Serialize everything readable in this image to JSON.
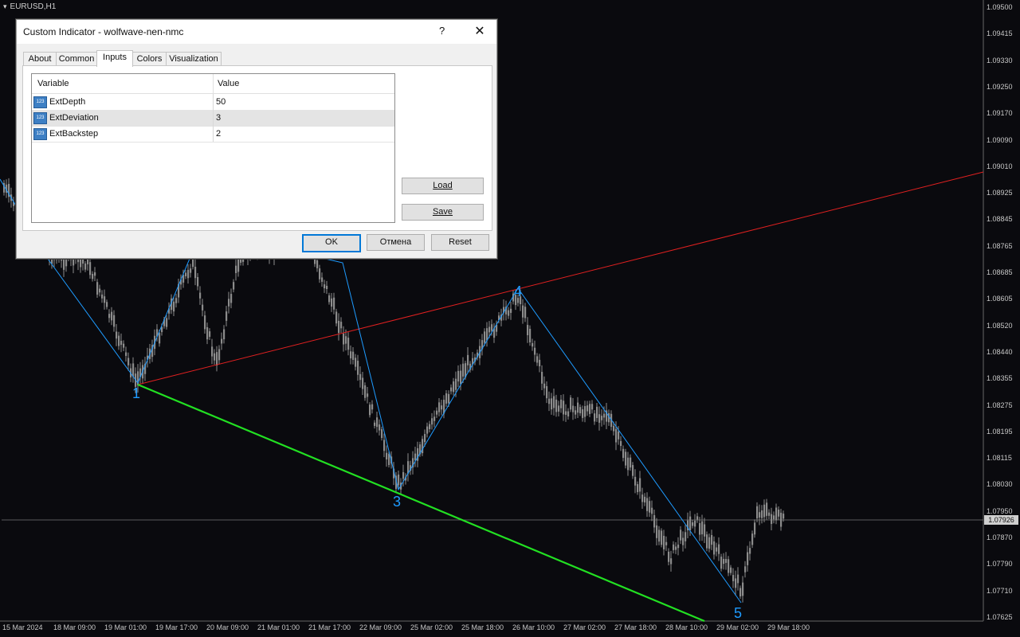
{
  "chart": {
    "symbol": "EURUSD,H1",
    "price_ticks": [
      "1.09500",
      "1.09415",
      "1.09330",
      "1.09250",
      "1.09170",
      "1.09090",
      "1.09010",
      "1.08925",
      "1.08845",
      "1.08765",
      "1.08685",
      "1.08605",
      "1.08520",
      "1.08440",
      "1.08355",
      "1.08275",
      "1.08195",
      "1.08115",
      "1.08030",
      "1.07950",
      "1.07870",
      "1.07790",
      "1.07710",
      "1.07625"
    ],
    "current_price": "1.07926",
    "time_ticks": [
      "15 Mar 2024",
      "18 Mar 09:00",
      "19 Mar 01:00",
      "19 Mar 17:00",
      "20 Mar 09:00",
      "21 Mar 01:00",
      "21 Mar 17:00",
      "22 Mar 09:00",
      "25 Mar 02:00",
      "25 Mar 18:00",
      "26 Mar 10:00",
      "27 Mar 02:00",
      "27 Mar 18:00",
      "28 Mar 10:00",
      "29 Mar 02:00",
      "29 Mar 18:00"
    ],
    "wave_labels": [
      "1",
      "3",
      "4",
      "5"
    ],
    "colors": {
      "background": "#0a0a0e",
      "candles": "#8c8c8c",
      "zigzag": "#1e9bff",
      "upper_line": "#e02020",
      "lower_line": "#22e022",
      "labels": "#1e9bff"
    }
  },
  "dialog": {
    "title": "Custom Indicator - wolfwave-nen-nmc",
    "help": "?",
    "close": "✕",
    "tabs": [
      "About",
      "Common",
      "Inputs",
      "Colors",
      "Visualization"
    ],
    "active_tab": "Inputs",
    "grid": {
      "headers": [
        "Variable",
        "Value"
      ],
      "rows": [
        {
          "icon": "123",
          "name": "ExtDepth",
          "value": "50"
        },
        {
          "icon": "123",
          "name": "ExtDeviation",
          "value": "3"
        },
        {
          "icon": "123",
          "name": "ExtBackstep",
          "value": "2"
        }
      ]
    },
    "buttons": {
      "load": "Load",
      "save": "Save",
      "ok": "OK",
      "cancel": "Отмена",
      "reset": "Reset"
    }
  }
}
